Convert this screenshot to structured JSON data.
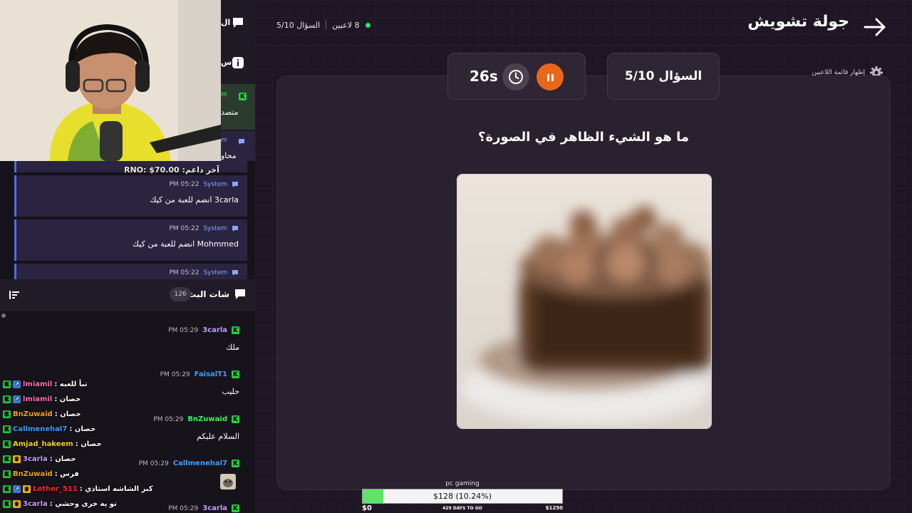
{
  "topbar": {
    "round_title": "جولة تشويش",
    "question_counter": "السؤال 5/10",
    "players_count": "8 لاعبين"
  },
  "controls": {
    "show_players": "إظهار قائمة اللاعبين",
    "question_box": "السؤال 5/10",
    "timer": "26s"
  },
  "question": {
    "text": "ما هو الشيء الظاهر في الصورة؟"
  },
  "goal": {
    "title": "pc gaming",
    "progress_text": "$128 (10.24%)",
    "progress_fraction": 0.1024,
    "min": "$0",
    "days_left": "429 DAYS TO GO",
    "max": "$1250"
  },
  "upper_panel": {
    "label_1": "ال",
    "label_2": "س",
    "pinned_1_user": "m",
    "pinned_1_text": "متصد",
    "pinned_2_user": "m",
    "pinned_2_text": "محاو"
  },
  "last_donor": "آخر داعم: RNO: $70.00",
  "system_messages": [
    {
      "author": "System",
      "time": "PM 05:22",
      "text": "3carla انضم للعبة من كيك"
    },
    {
      "author": "System",
      "time": "PM 05:22",
      "text": "Mohmmed انضم للعبة من كيك"
    },
    {
      "author": "System",
      "time": "PM 05:22",
      "text": ""
    }
  ],
  "chat": {
    "title": "شات البث",
    "count": "126",
    "messages": [
      {
        "user": "3carla",
        "time": "PM 05:29",
        "text": "ملك",
        "color": "#c79bff"
      },
      {
        "user": "FaisalT1",
        "time": "PM 05:29",
        "text": "حليب",
        "color": "#3aa0ff"
      },
      {
        "user": "BnZuwaid",
        "time": "PM 05:29",
        "text": "السلام عليكم",
        "color": "#3ef05a"
      },
      {
        "user": "Callmenehal7",
        "time": "PM 05:29",
        "text": "",
        "color": "#3aa0ff"
      },
      {
        "user": "3carla",
        "time": "PM 05:29",
        "text": "",
        "color": "#c79bff"
      }
    ]
  },
  "overlay_chat": [
    {
      "user": "lmiamil",
      "text": ": تبأ للعبه",
      "color": "#ff6fb5",
      "badges": [
        "k",
        "b"
      ]
    },
    {
      "user": "lmiamil",
      "text": ": حصان",
      "color": "#ff6fb5",
      "badges": [
        "k",
        "b"
      ]
    },
    {
      "user": "BnZuwaid",
      "text": ": حصان",
      "color": "#f2a31a",
      "badges": [
        "k"
      ]
    },
    {
      "user": "Callmenehal7",
      "text": ": حصان",
      "color": "#3aa0ff",
      "badges": [
        "k"
      ]
    },
    {
      "user": "Amjad_hakeem",
      "text": ": حصان",
      "color": "#f2d21a",
      "badges": [
        "k"
      ]
    },
    {
      "user": "3carla",
      "text": ": حصان",
      "color": "#c79bff",
      "badges": [
        "k",
        "g"
      ]
    },
    {
      "user": "BnZuwaid",
      "text": ": فرس",
      "color": "#f2a31a",
      "badges": [
        "k"
      ]
    },
    {
      "user": "Lother_511",
      "text": ": كبر الشاشه استاذي",
      "color": "#ff2a2a",
      "badges": [
        "k",
        "b",
        "g"
      ]
    },
    {
      "user": "3carla",
      "text": ": تو يه خرى وحشي",
      "color": "#c79bff",
      "badges": [
        "k",
        "g"
      ]
    }
  ],
  "colors": {
    "accent": "#e8671a",
    "online": "#2ee06a",
    "kick_green": "#21d23b",
    "goal_fill": "#5fe36b"
  }
}
